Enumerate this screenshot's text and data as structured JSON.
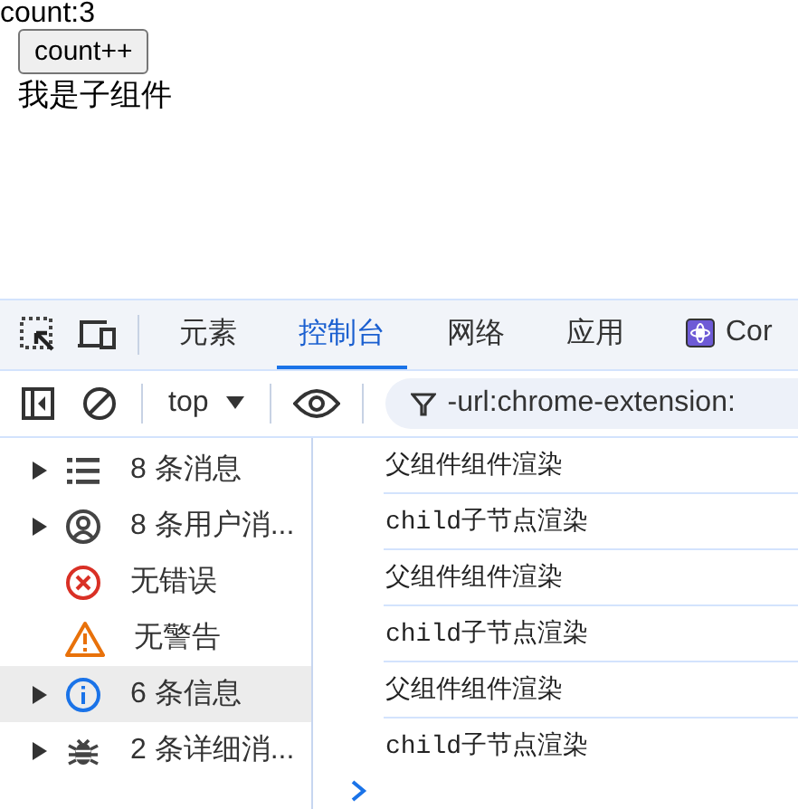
{
  "page": {
    "count_text": "count:3",
    "button_label": "count++",
    "child_text": "我是子组件"
  },
  "devtools": {
    "tabs": [
      {
        "label": "元素",
        "selected": false
      },
      {
        "label": "控制台",
        "selected": true
      },
      {
        "label": "网络",
        "selected": false
      },
      {
        "label": "应用",
        "selected": false
      },
      {
        "label": "Cor",
        "selected": false,
        "kind": "extension"
      }
    ],
    "context": "top",
    "filter": "-url:chrome-extension:",
    "sidebar": [
      {
        "kind": "list",
        "label": "8 条消息",
        "expandable": true,
        "selected": false
      },
      {
        "kind": "user",
        "label": "8 条用户消...",
        "expandable": true,
        "selected": false
      },
      {
        "kind": "error",
        "label": "无错误",
        "expandable": false,
        "selected": false
      },
      {
        "kind": "warning",
        "label": "无警告",
        "expandable": false,
        "selected": false
      },
      {
        "kind": "info",
        "label": "6 条信息",
        "expandable": true,
        "selected": true
      },
      {
        "kind": "verbose",
        "label": "2 条详细消...",
        "expandable": true,
        "selected": false
      }
    ],
    "messages": [
      "父组件组件渲染",
      "child子节点渲染",
      "父组件组件渲染",
      "child子节点渲染",
      "父组件组件渲染",
      "child子节点渲染"
    ]
  }
}
